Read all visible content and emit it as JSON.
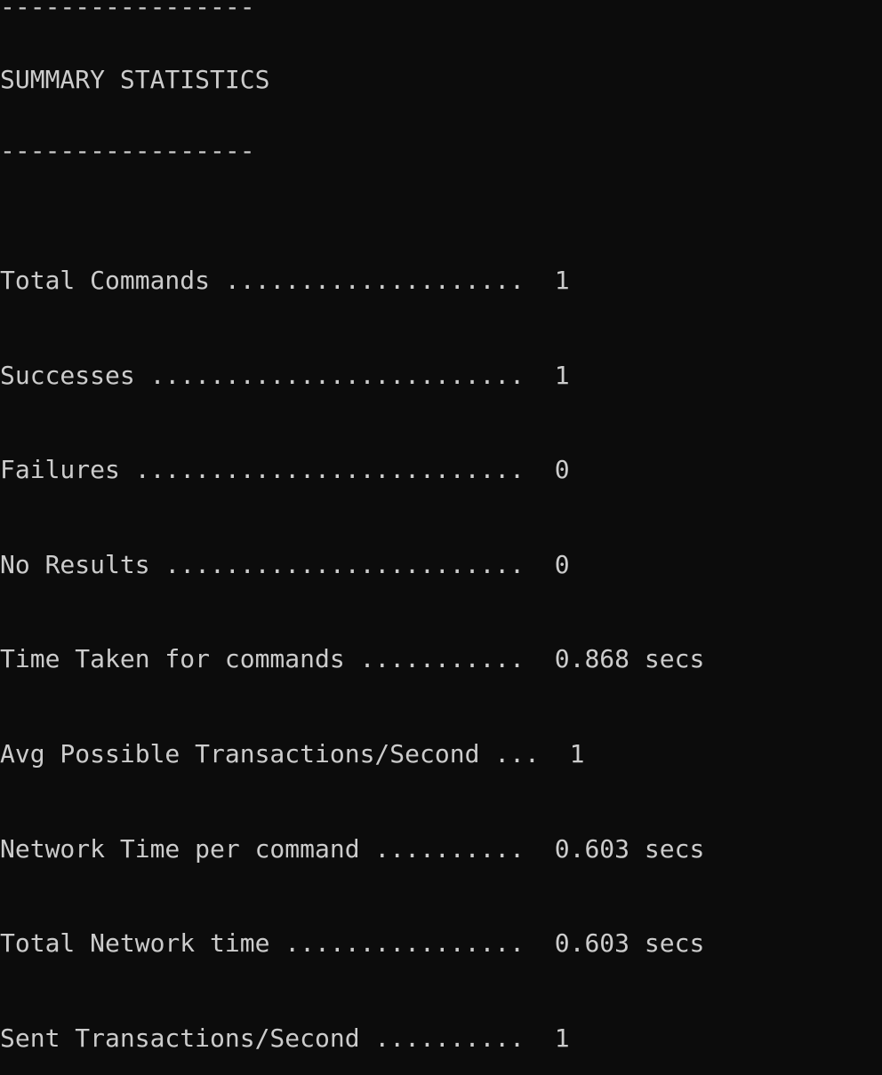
{
  "console": {
    "divider": "-----------------",
    "heading": "SUMMARY STATISTICS",
    "stats": [
      "Total Commands ....................  1",
      "Successes .........................  1",
      "Failures ..........................  0",
      "No Results ........................  0",
      "Time Taken for commands ...........  0.868 secs",
      "Avg Possible Transactions/Second ...  1",
      "Network Time per command ..........  0.603 secs",
      "Total Network time ................  0.603 secs",
      "Sent Transactions/Second ..........  1"
    ]
  },
  "colors": {
    "background": "#0c0c0c",
    "text": "#cccccc"
  }
}
